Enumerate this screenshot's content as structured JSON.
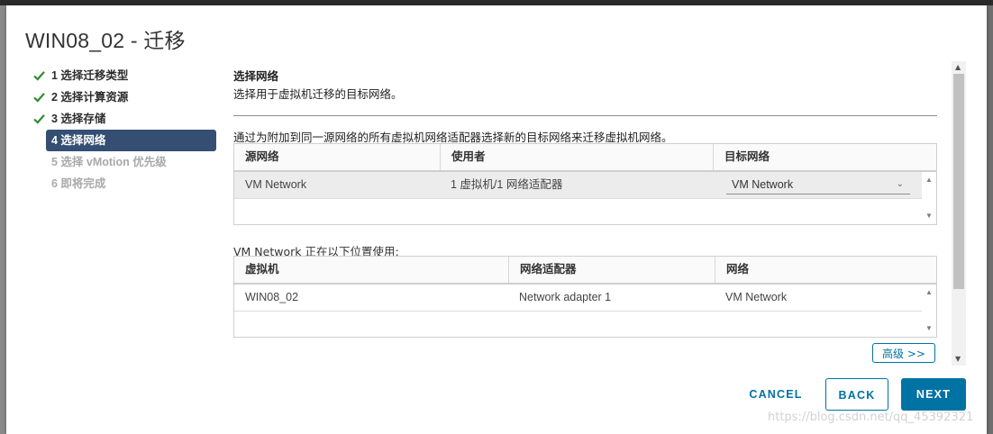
{
  "dialog": {
    "title": "WIN08_02 - 迁移"
  },
  "steps": [
    {
      "label": "1 选择迁移类型",
      "state": "done"
    },
    {
      "label": "2 选择计算资源",
      "state": "done"
    },
    {
      "label": "3 选择存储",
      "state": "done"
    },
    {
      "label": "4 选择网络",
      "state": "active"
    },
    {
      "label": "5 选择 vMotion 优先级",
      "state": "disabled"
    },
    {
      "label": "6 即将完成",
      "state": "disabled"
    }
  ],
  "section": {
    "title": "选择网络",
    "description": "选择用于虚拟机迁移的目标网络。",
    "instruction": "通过为附加到同一源网络的所有虚拟机网络适配器选择新的目标网络来迁移虚拟机网络。"
  },
  "network_table": {
    "headers": [
      "源网络",
      "使用者",
      "目标网络"
    ],
    "rows": [
      {
        "source": "VM Network",
        "used_by": "1 虚拟机/1 网络适配器",
        "destination": "VM Network"
      }
    ]
  },
  "usage": {
    "label": "VM Network 正在以下位置使用:",
    "headers": [
      "虚拟机",
      "网络适配器",
      "网络"
    ],
    "rows": [
      {
        "vm": "WIN08_02",
        "adapter": "Network adapter 1",
        "network": "VM Network"
      }
    ]
  },
  "advanced_button": "高级 >>",
  "footer": {
    "cancel": "CANCEL",
    "back": "BACK",
    "next": "NEXT"
  },
  "watermark": "https://blog.csdn.net/qq_45392321",
  "colors": {
    "accent": "#0072a3",
    "active_step_bg": "#344f73",
    "check_green": "#2e8b2e"
  }
}
